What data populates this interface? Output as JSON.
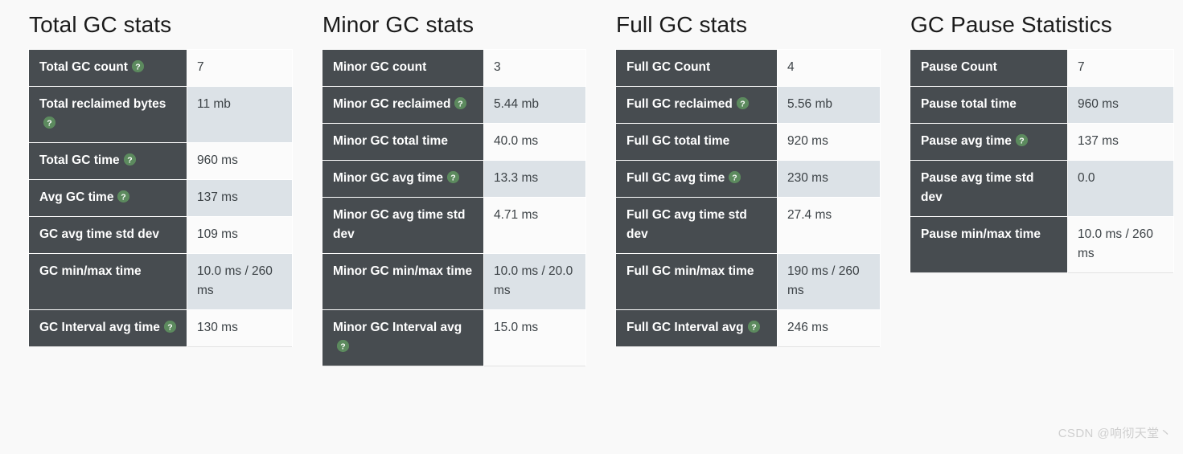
{
  "help_icon": "help-circle-icon",
  "colors": {
    "page_background": "#f9f9f9",
    "header_cell": "#474c50",
    "header_text": "#ffffff",
    "row_odd": "#fbfbfb",
    "row_even": "#dce2e7",
    "value_text": "#3c4246",
    "help_icon_green": "#5c8a5e",
    "title_text": "#1b1b1b",
    "watermark_text": "#cfcfcf"
  },
  "watermark": "CSDN @响彻天堂丶",
  "panels": [
    {
      "title": "Total GC stats",
      "rows": [
        {
          "label": "Total GC count",
          "help": true,
          "value": "7"
        },
        {
          "label": "Total reclaimed bytes",
          "help": true,
          "value": "11 mb"
        },
        {
          "label": "Total GC time",
          "help": true,
          "value": "960 ms"
        },
        {
          "label": "Avg GC time",
          "help": true,
          "value": "137 ms"
        },
        {
          "label": "GC avg time std dev",
          "help": false,
          "value": "109 ms"
        },
        {
          "label": "GC min/max time",
          "help": false,
          "value": "10.0 ms / 260 ms"
        },
        {
          "label": "GC Interval avg time",
          "help": true,
          "value": "130 ms"
        }
      ]
    },
    {
      "title": "Minor GC stats",
      "rows": [
        {
          "label": "Minor GC count",
          "help": false,
          "value": "3"
        },
        {
          "label": "Minor GC reclaimed",
          "help": true,
          "value": "5.44 mb"
        },
        {
          "label": "Minor GC total time",
          "help": false,
          "value": "40.0 ms"
        },
        {
          "label": "Minor GC avg time",
          "help": true,
          "value": "13.3 ms"
        },
        {
          "label": "Minor GC avg time std dev",
          "help": false,
          "value": "4.71 ms"
        },
        {
          "label": "Minor GC min/max time",
          "help": false,
          "value": "10.0 ms / 20.0 ms"
        },
        {
          "label": "Minor GC Interval avg",
          "help": true,
          "value": "15.0 ms"
        }
      ]
    },
    {
      "title": "Full GC stats",
      "rows": [
        {
          "label": "Full GC Count",
          "help": false,
          "value": "4"
        },
        {
          "label": "Full GC reclaimed",
          "help": true,
          "value": "5.56 mb"
        },
        {
          "label": "Full GC total time",
          "help": false,
          "value": "920 ms"
        },
        {
          "label": "Full GC avg time",
          "help": true,
          "value": "230 ms"
        },
        {
          "label": "Full GC avg time std dev",
          "help": false,
          "value": "27.4 ms"
        },
        {
          "label": "Full GC min/max time",
          "help": false,
          "value": "190 ms / 260 ms"
        },
        {
          "label": "Full GC Interval avg",
          "help": true,
          "value": "246 ms"
        }
      ]
    },
    {
      "title": "GC Pause Statistics",
      "rows": [
        {
          "label": "Pause Count",
          "help": false,
          "value": "7"
        },
        {
          "label": "Pause total time",
          "help": false,
          "value": "960 ms"
        },
        {
          "label": "Pause avg time",
          "help": true,
          "value": "137 ms"
        },
        {
          "label": "Pause avg time std dev",
          "help": false,
          "value": "0.0"
        },
        {
          "label": "Pause min/max time",
          "help": false,
          "value": "10.0 ms / 260 ms"
        }
      ]
    }
  ]
}
